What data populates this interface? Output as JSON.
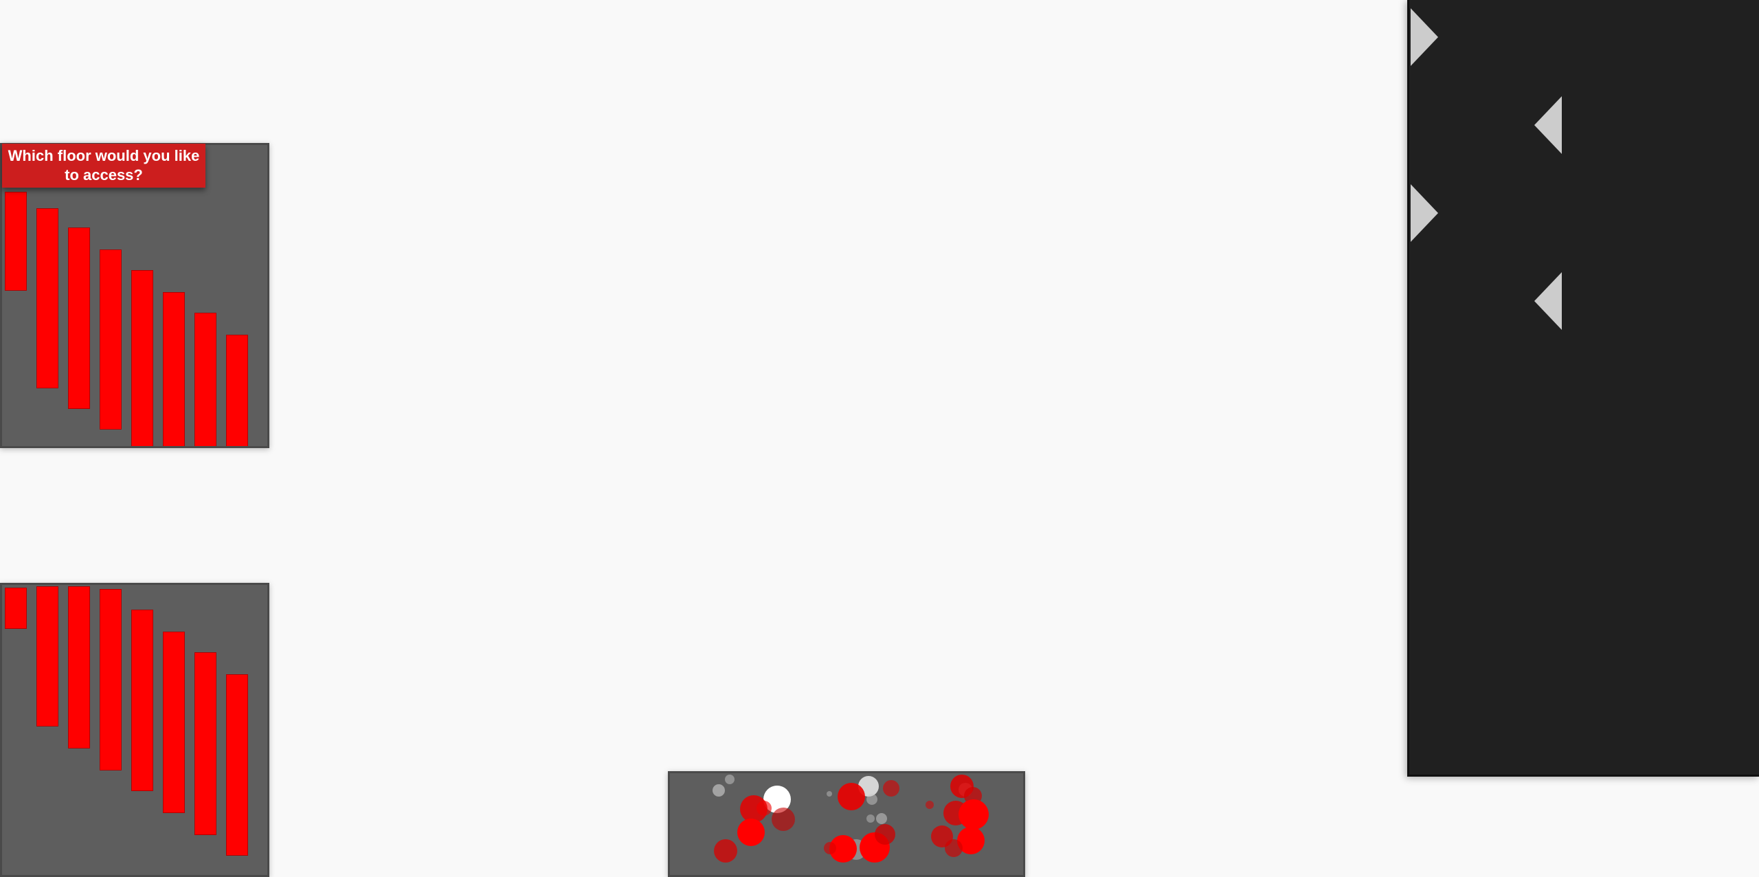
{
  "prompt": {
    "text": "Which floor would you like to access?"
  },
  "colors": {
    "background": "#f9f9f9",
    "panel": "#5e5e5e",
    "bar": "#ff0000",
    "banner": "#cc1e1e",
    "dark_panel": "#202020",
    "arrow": "#cccccc"
  },
  "icons": {
    "arrow_right": "triangle-right-icon",
    "arrow_left": "triangle-left-icon"
  }
}
